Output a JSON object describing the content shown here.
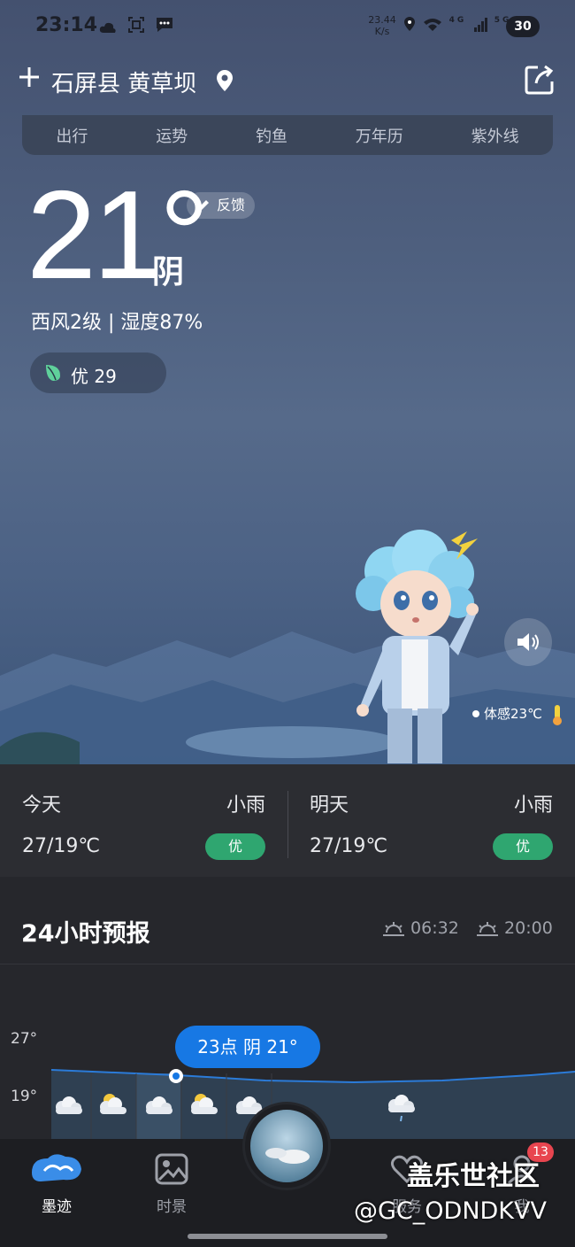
{
  "status_bar": {
    "time": "23:14",
    "net_speed_value": "23.44",
    "net_speed_unit": "K/s",
    "signal_1": "4G",
    "signal_2": "5G",
    "battery": "30"
  },
  "header": {
    "location": "石屏县 黄草坝",
    "add_icon": "plus-icon",
    "pin_icon": "location-pin-icon",
    "share_icon": "share-icon"
  },
  "tools": [
    "出行",
    "运势",
    "钓鱼",
    "万年历",
    "紫外线"
  ],
  "current": {
    "temperature": "21°",
    "condition": "阴",
    "wind_humidity": "西风2级 | 湿度87%",
    "feedback_label": "反馈",
    "aqi": "优 29",
    "feels_like": "体感23℃"
  },
  "daily": [
    {
      "day": "今天",
      "condition": "小雨",
      "range": "27/19℃",
      "aqi": "优"
    },
    {
      "day": "明天",
      "condition": "小雨",
      "range": "27/19℃",
      "aqi": "优"
    }
  ],
  "forecast": {
    "title": "24小时预报",
    "sunrise": "06:32",
    "sunset": "20:00",
    "y_max_label": "27°",
    "y_min_label": "19°",
    "tooltip": "23点 阴 21°",
    "hour_icons": [
      "cloudy",
      "partly-cloudy-night",
      "cloudy",
      "partly-cloudy-night",
      "cloudy",
      "rain-cloud"
    ]
  },
  "nav": {
    "items": [
      {
        "label": "墨迹",
        "active": true
      },
      {
        "label": "时景",
        "active": false
      },
      {
        "label": "服务",
        "active": false
      },
      {
        "label": "我",
        "active": false
      }
    ],
    "badge": "13"
  },
  "watermark": {
    "line1": "盖乐世社区",
    "line2": "@GC_ODNDKVV"
  },
  "colors": {
    "aqi_good": "#2fa670",
    "tooltip": "#1778e4",
    "badge": "#e8454f"
  }
}
